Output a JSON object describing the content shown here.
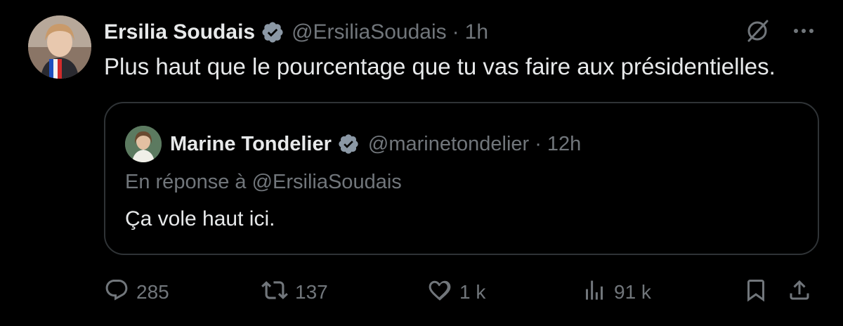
{
  "tweet": {
    "author": {
      "display_name": "Ersilia Soudais",
      "handle": "@ErsiliaSoudais",
      "verified": true
    },
    "separator": "·",
    "time": "1h",
    "text": "Plus haut que le pourcentage que tu vas faire aux présidentielles."
  },
  "quoted_tweet": {
    "author": {
      "display_name": "Marine Tondelier",
      "handle": "@marinetondelier",
      "verified": true
    },
    "separator": "·",
    "time": "12h",
    "reply_to": "En réponse à @ErsiliaSoudais",
    "text": "Ça vole haut ici."
  },
  "actions": {
    "reply_count": "285",
    "retweet_count": "137",
    "like_count": "1 k",
    "views_count": "91 k"
  },
  "icons": {
    "grok": "grok-icon",
    "more": "more-icon",
    "reply": "reply-icon",
    "retweet": "retweet-icon",
    "like": "heart-icon",
    "views": "views-icon",
    "bookmark": "bookmark-icon",
    "share": "share-icon",
    "verified": "verified-badge-icon"
  },
  "colors": {
    "background": "#000000",
    "text_primary": "#e7e9ea",
    "text_secondary": "#71767b",
    "border": "#2f3336",
    "verified_badge": "#8b98a5"
  }
}
